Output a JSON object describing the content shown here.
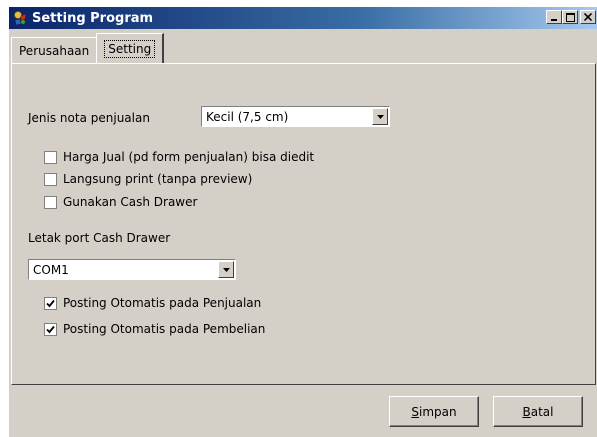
{
  "window": {
    "title": "Setting Program",
    "controls": {
      "minimize": "minimize",
      "maximize": "maximize",
      "close": "close"
    }
  },
  "tabs": [
    {
      "label": "Perusahaan",
      "active": false
    },
    {
      "label": "Setting",
      "active": true
    }
  ],
  "setting": {
    "jenis_nota_label": "Jenis nota penjualan",
    "jenis_nota_value": "Kecil (7,5 cm)",
    "options": [
      {
        "label": "Harga Jual (pd form penjualan) bisa diedit",
        "checked": false
      },
      {
        "label": "Langsung print (tanpa preview)",
        "checked": false
      },
      {
        "label": "Gunakan Cash Drawer",
        "checked": false
      }
    ],
    "port_label": "Letak port Cash Drawer",
    "port_value": "COM1",
    "posting": [
      {
        "label": "Posting Otomatis pada Penjualan",
        "checked": true
      },
      {
        "label": "Posting Otomatis pada Pembelian",
        "checked": true
      }
    ]
  },
  "buttons": {
    "save_first": "S",
    "save_rest": "impan",
    "cancel_first": "B",
    "cancel_rest": "atal"
  },
  "colors": {
    "titlebar_start": "#0a246a",
    "titlebar_end": "#a6caf0",
    "face": "#d4d0c8"
  },
  "icons": {
    "app": "program-icon",
    "combo": "chevron-down-icon",
    "check": "checkmark-icon"
  }
}
